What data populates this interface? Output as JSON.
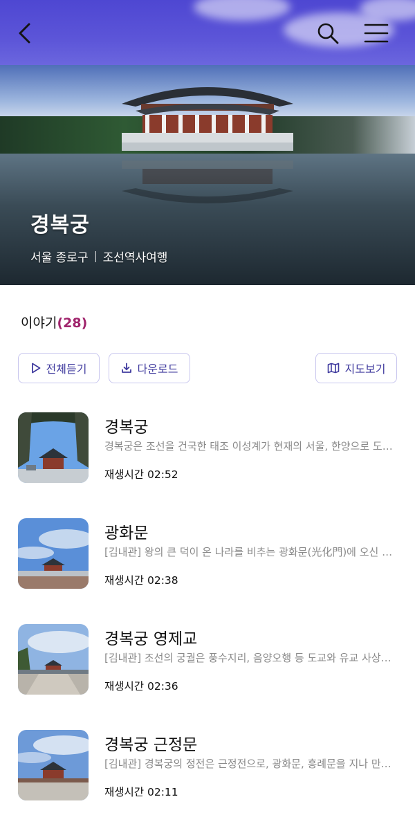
{
  "header": {
    "place_title": "경복궁",
    "location": "서울 종로구",
    "category": "조선역사여행"
  },
  "story": {
    "label": "이야기",
    "count": "(28)"
  },
  "actions": {
    "play_all": "전체듣기",
    "download": "다운로드",
    "map_view": "지도보기"
  },
  "items": [
    {
      "title": "경복궁",
      "desc": "경복궁은 조선을 건국한 태조 이성계가 현재의 서울, 한양으로 도읍을 옮긴 뒤 세운 궁궐입니다.",
      "time": "재생시간 02:52"
    },
    {
      "title": "광화문",
      "desc": "[김내관] 왕의 큰 덕이 온 나라를 비추는 광화문(光化門)에 오신 것을 환영합니다.",
      "time": "재생시간 02:38"
    },
    {
      "title": "경복궁 영제교",
      "desc": "[김내관] 조선의 궁궐은 풍수지리, 음양오행 등 도교와 유교 사상을 바탕으로 지어졌습니다.",
      "time": "재생시간 02:36"
    },
    {
      "title": "경복궁 근정문",
      "desc": "[김내관] 경복궁의 정전은 근정전으로, 광화문, 흥례문을 지나 만나게 되는 문입니다.",
      "time": "재생시간 02:11"
    }
  ],
  "colors": {
    "accent": "#3f3a9e",
    "count": "#a0246c",
    "topbar": "#5c55d8"
  }
}
